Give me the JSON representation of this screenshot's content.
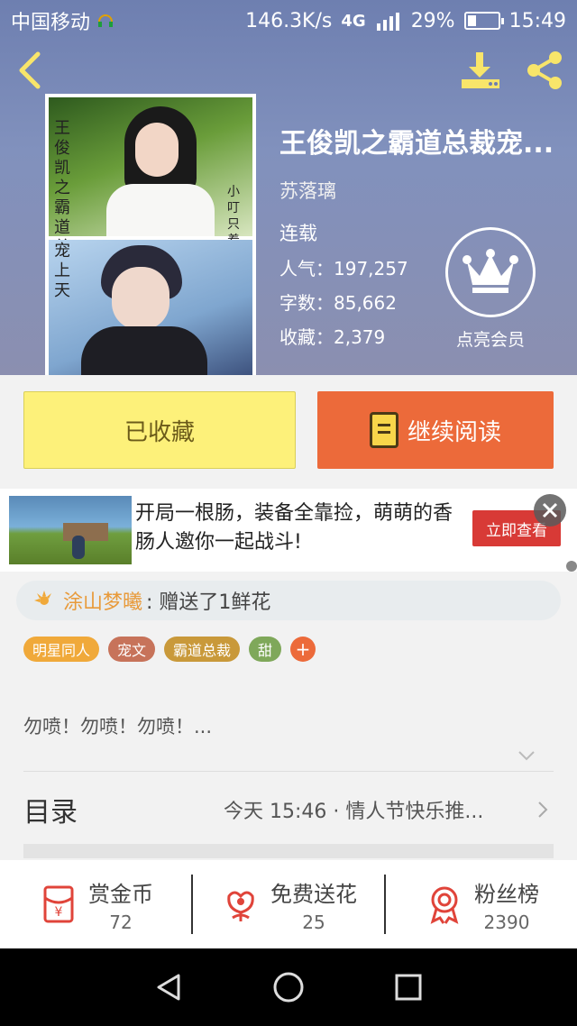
{
  "status_bar": {
    "carrier": "中国移动",
    "speed": "146.3K/s",
    "network": "4G",
    "battery": "29%",
    "battery_level": 0.29,
    "time": "15:49"
  },
  "book": {
    "title": "王俊凯之霸道总裁宠...",
    "author": "苏落璃",
    "status": "连载",
    "popularity_label": "人气：",
    "popularity": "197,257",
    "words_label": "字数：",
    "words": "85,662",
    "favorites_label": "收藏：",
    "favorites": "2,379",
    "cover": {
      "top_vertical_text": "王俊凯之霸道总裁宠上",
      "author_vertical_text": "小叮只着",
      "bottom_vertical_text": "宠上天"
    }
  },
  "vip": {
    "label": "点亮会员"
  },
  "actions": {
    "collected_label": "已收藏",
    "continue_label": "继续阅读"
  },
  "ad": {
    "text": "开局一根肠，装备全靠捡，萌萌的香肠人邀你一起战斗!",
    "cta": "立即查看"
  },
  "gift": {
    "name": "涂山梦曦",
    "message": ": 赠送了1鲜花"
  },
  "tags": [
    {
      "label": "明星同人",
      "color": "#f0a93a"
    },
    {
      "label": "宠文",
      "color": "#c7735a"
    },
    {
      "label": "霸道总裁",
      "color": "#c9993a"
    },
    {
      "label": "甜",
      "color": "#7fa85a"
    },
    {
      "label": "+",
      "color": "#ec6a3a"
    }
  ],
  "intro": "勿喷！勿喷！勿喷！...",
  "toc": {
    "title": "目录",
    "latest": "今天 15:46 · 情人节快乐推..."
  },
  "bottom_stats": [
    {
      "label": "赏金币",
      "value": "72",
      "icon": "red-envelope-icon"
    },
    {
      "label": "免费送花",
      "value": "25",
      "icon": "flower-icon"
    },
    {
      "label": "粉丝榜",
      "value": "2390",
      "icon": "medal-icon"
    }
  ],
  "colors": {
    "accent_orange": "#ec6a3a",
    "collected_yellow": "#fdf17a",
    "icon_yellow": "#f8e56a",
    "icon_red": "#e0443a"
  }
}
